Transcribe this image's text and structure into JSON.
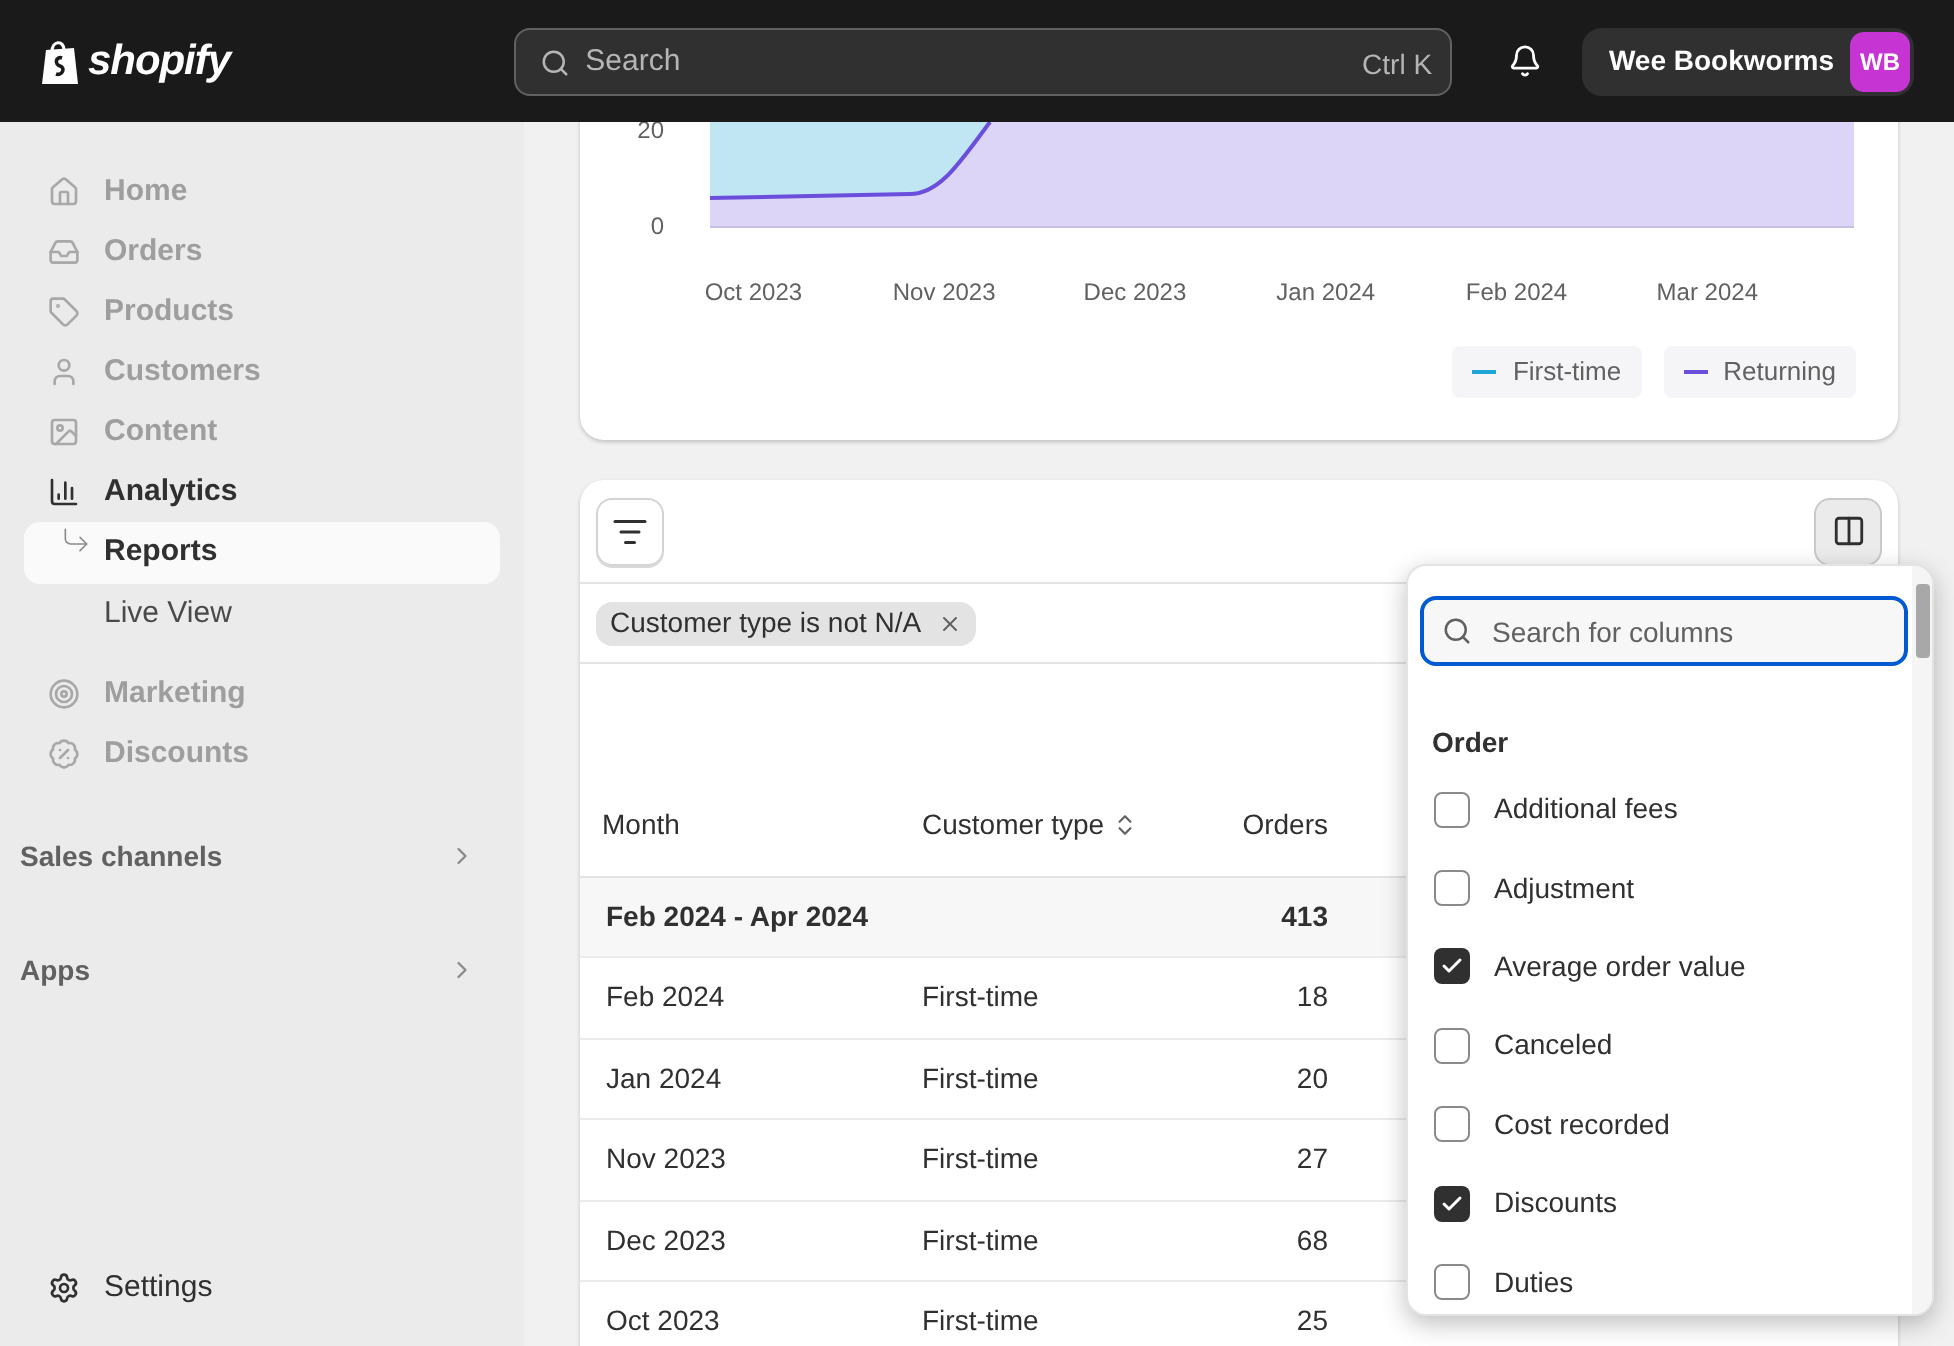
{
  "header": {
    "logo": "shopify",
    "search": {
      "placeholder": "Search",
      "shortcut": "Ctrl K"
    },
    "store": {
      "name": "Wee Bookworms",
      "initials": "WB"
    }
  },
  "sidebar": {
    "items": [
      {
        "label": "Home",
        "disabled": true
      },
      {
        "label": "Orders",
        "disabled": true
      },
      {
        "label": "Products",
        "disabled": true
      },
      {
        "label": "Customers",
        "disabled": true
      },
      {
        "label": "Content",
        "disabled": true
      },
      {
        "label": "Analytics",
        "disabled": false,
        "children": [
          {
            "label": "Reports",
            "selected": true
          },
          {
            "label": "Live View",
            "selected": false
          }
        ]
      },
      {
        "label": "Marketing",
        "disabled": true
      },
      {
        "label": "Discounts",
        "disabled": true
      }
    ],
    "sections": [
      {
        "label": "Sales channels"
      },
      {
        "label": "Apps"
      }
    ],
    "settings": {
      "label": "Settings"
    }
  },
  "chart": {
    "y_labels": [
      "20",
      "0"
    ],
    "x_labels": [
      "Oct 2023",
      "Nov 2023",
      "Dec 2023",
      "Jan 2024",
      "Feb 2024",
      "Mar 2024"
    ],
    "legend": [
      {
        "label": "First-time",
        "color": "#1ea5d8"
      },
      {
        "label": "Returning",
        "color": "#6b4fdc"
      }
    ]
  },
  "table": {
    "filter_chip": "Customer type is not N/A",
    "columns": [
      {
        "label": "Month",
        "sortable": false
      },
      {
        "label": "Customer type",
        "sortable": true
      },
      {
        "label": "Orders",
        "sortable": false
      }
    ],
    "summary": {
      "month": "Feb 2024 - Apr 2024",
      "orders": "413"
    },
    "rows": [
      {
        "month": "Feb 2024",
        "customer_type": "First-time",
        "orders": "18"
      },
      {
        "month": "Jan 2024",
        "customer_type": "First-time",
        "orders": "20"
      },
      {
        "month": "Nov 2023",
        "customer_type": "First-time",
        "orders": "27"
      },
      {
        "month": "Dec 2023",
        "customer_type": "First-time",
        "orders": "68"
      },
      {
        "month": "Oct 2023",
        "customer_type": "First-time",
        "orders": "25"
      }
    ]
  },
  "column_picker": {
    "search": {
      "placeholder": "Search for columns"
    },
    "section": "Order",
    "items": [
      {
        "label": "Additional fees",
        "checked": false
      },
      {
        "label": "Adjustment",
        "checked": false
      },
      {
        "label": "Average order value",
        "checked": true
      },
      {
        "label": "Canceled",
        "checked": false
      },
      {
        "label": "Cost recorded",
        "checked": false
      },
      {
        "label": "Discounts",
        "checked": true
      },
      {
        "label": "Duties",
        "checked": false
      }
    ]
  }
}
